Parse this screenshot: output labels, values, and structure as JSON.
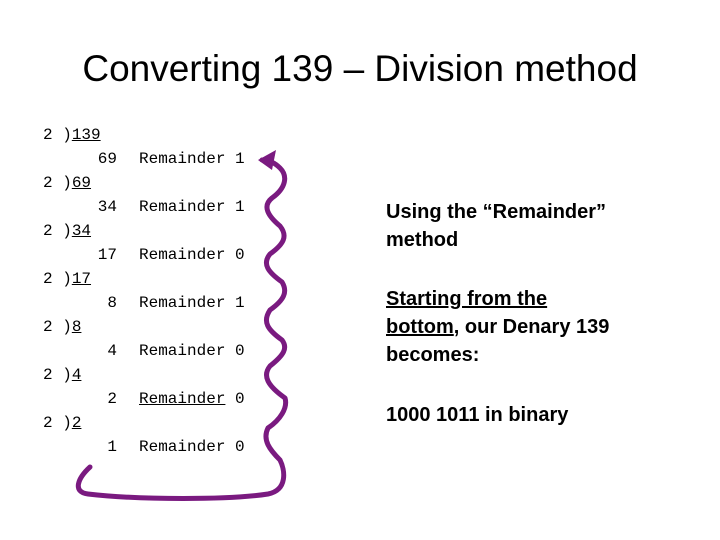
{
  "title": "Converting 139 – Division method",
  "steps": [
    {
      "divisor": "2 )",
      "dividend": "139",
      "quotient": "69",
      "remainder_label": "Remainder",
      "remainder": "1",
      "label_underlined": false
    },
    {
      "divisor": "2 )",
      "dividend": "69",
      "quotient": "34",
      "remainder_label": "Remainder",
      "remainder": "1",
      "label_underlined": false
    },
    {
      "divisor": "2 )",
      "dividend": "34",
      "quotient": "17",
      "remainder_label": "Remainder",
      "remainder": "0",
      "label_underlined": false
    },
    {
      "divisor": "2 )",
      "dividend": "17",
      "quotient": "8",
      "remainder_label": "Remainder",
      "remainder": "1",
      "label_underlined": false
    },
    {
      "divisor": "2 )",
      "dividend": "8",
      "quotient": "4",
      "remainder_label": "Remainder",
      "remainder": "0",
      "label_underlined": false
    },
    {
      "divisor": "2 )",
      "dividend": "4",
      "quotient": "2",
      "remainder_label": "Remainder",
      "remainder": "0",
      "label_underlined": true
    },
    {
      "divisor": "2 )",
      "dividend": "2",
      "quotient": "1",
      "remainder_label": "Remainder",
      "remainder": "0",
      "label_underlined": false
    }
  ],
  "explanation": {
    "line1": "Using the “Remainder”",
    "line2": "method",
    "start_underlined": "Starting from the",
    "bottom_underlined": "bottom",
    "after_bottom": ", our Denary 139",
    "becomes": "becomes:",
    "result": "1000 1011 in binary"
  },
  "arrow_color": "#7a1a80"
}
